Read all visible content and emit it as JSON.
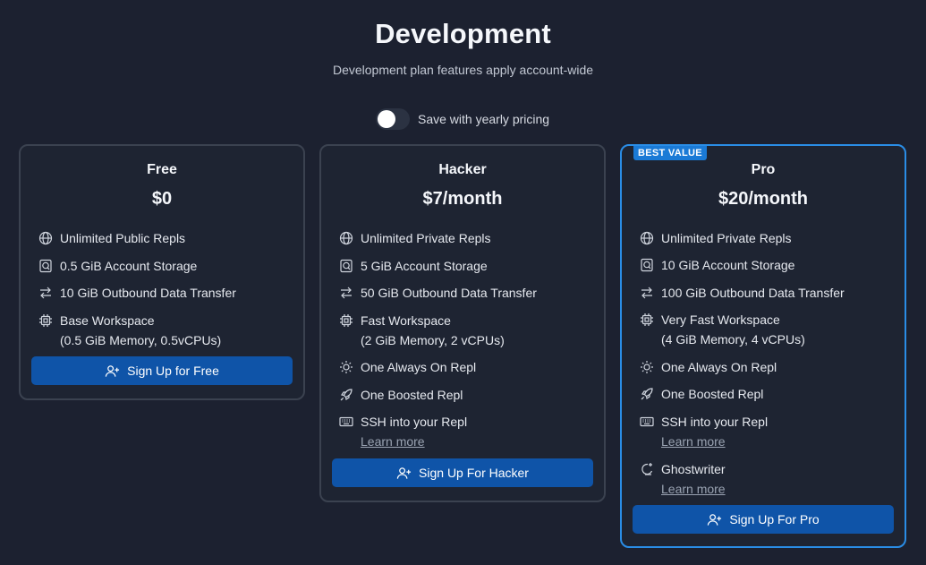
{
  "header": {
    "title": "Development",
    "subtitle": "Development plan features apply account-wide"
  },
  "toggle": {
    "label": "Save with yearly pricing",
    "on": false
  },
  "plans": [
    {
      "name": "Free",
      "price": "$0",
      "features": [
        {
          "icon": "globe-icon",
          "text": "Unlimited Public Repls"
        },
        {
          "icon": "storage-icon",
          "text": "0.5 GiB Account Storage"
        },
        {
          "icon": "transfer-icon",
          "text": "10 GiB Outbound Data Transfer"
        },
        {
          "icon": "cpu-icon",
          "text": "Base Workspace",
          "sub": "(0.5 GiB Memory, 0.5vCPUs)"
        }
      ],
      "button": "Sign Up for Free"
    },
    {
      "name": "Hacker",
      "price": "$7/month",
      "features": [
        {
          "icon": "globe-icon",
          "text": "Unlimited Private Repls"
        },
        {
          "icon": "storage-icon",
          "text": "5 GiB Account Storage"
        },
        {
          "icon": "transfer-icon",
          "text": "50 GiB Outbound Data Transfer"
        },
        {
          "icon": "cpu-icon",
          "text": "Fast Workspace",
          "sub": "(2 GiB Memory, 2 vCPUs)"
        },
        {
          "icon": "sun-icon",
          "text": "One Always On Repl"
        },
        {
          "icon": "rocket-icon",
          "text": "One Boosted Repl"
        },
        {
          "icon": "keyboard-icon",
          "text": "SSH into your Repl",
          "link": "Learn more"
        }
      ],
      "button": "Sign Up For Hacker"
    },
    {
      "name": "Pro",
      "price": "$20/month",
      "badge": "BEST VALUE",
      "features": [
        {
          "icon": "globe-icon",
          "text": "Unlimited Private Repls"
        },
        {
          "icon": "storage-icon",
          "text": "10 GiB Account Storage"
        },
        {
          "icon": "transfer-icon",
          "text": "100 GiB Outbound Data Transfer"
        },
        {
          "icon": "cpu-icon",
          "text": "Very Fast Workspace",
          "sub": "(4 GiB Memory, 4 vCPUs)"
        },
        {
          "icon": "sun-icon",
          "text": "One Always On Repl"
        },
        {
          "icon": "rocket-icon",
          "text": "One Boosted Repl"
        },
        {
          "icon": "keyboard-icon",
          "text": "SSH into your Repl",
          "link": "Learn more"
        },
        {
          "icon": "ghostwriter-icon",
          "text": "Ghostwriter",
          "link": "Learn more"
        }
      ],
      "button": "Sign Up For Pro"
    }
  ],
  "colors": {
    "background": "#1c2130",
    "accent": "#2a8de6",
    "button": "#0f54a8"
  }
}
